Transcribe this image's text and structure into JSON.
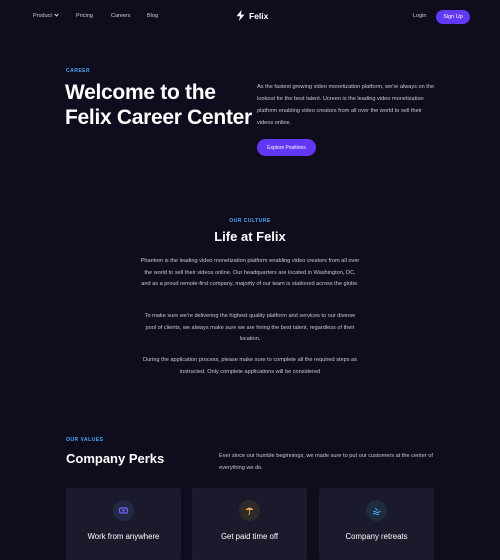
{
  "nav": {
    "links": [
      "Product",
      "Pricing",
      "Careers",
      "Blog"
    ],
    "brand": "Felix",
    "login": "Login",
    "signup": "Sign Up"
  },
  "hero": {
    "eyebrow": "CAREER",
    "title": "Welcome to the Felix Career Center",
    "description": "As the fastest growing video monetization platform, we're always on the lookout for the best talent. Ucreen is the leading video monetization platform enabling video creators from all over the world to sell their videos online.",
    "cta": "Explore Positions"
  },
  "culture": {
    "eyebrow": "OUR CULTURE",
    "title": "Life at Felix",
    "paragraphs": [
      "Phantom is the leading video monetization platform enabling video creators from all over the world to sell their videos online. Our headquarters are located in Washington, DC, and as a proud remote-first company, majority of our team is stationed across the globe.",
      "To make sure we're delivering the highest quality platform and services to our diverse pool of clients, we always make sure we are hiring the best talent, regardless of their location.",
      "During the application process, please make sure to complete all the required steps as instructed. Only complete applications will be considered"
    ]
  },
  "values": {
    "eyebrow": "OUR VALUES",
    "title": "Company Perks",
    "description": "Ever since our humble beginnings, we made sure to put our customers at the center of everything we do."
  },
  "perks": [
    {
      "label": "Work from anywhere",
      "icon": "remote-icon",
      "color": "#6f5bf6"
    },
    {
      "label": "Get paid time off",
      "icon": "umbrella-icon",
      "color": "#f0a04b"
    },
    {
      "label": "Company retreats",
      "icon": "retreat-icon",
      "color": "#4fa9f5"
    }
  ],
  "colors": {
    "background": "#0e0c1d",
    "accent": "#6138f5",
    "eyebrow": "#4fa9f5",
    "card": "#1b1a2c"
  }
}
